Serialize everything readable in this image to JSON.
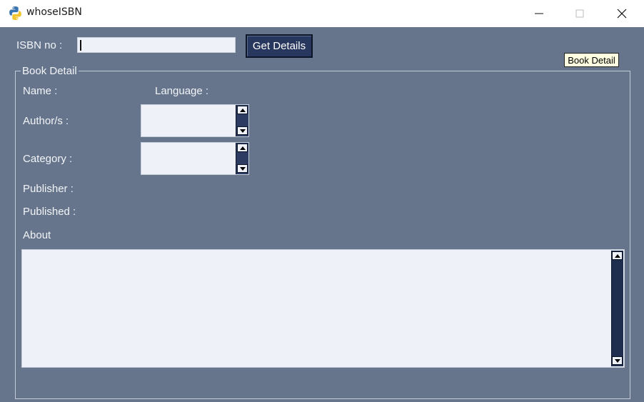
{
  "window": {
    "title": "whoseISBN",
    "icon": "python-icon",
    "controls": [
      "minimize-icon",
      "maximize-icon",
      "close-icon"
    ]
  },
  "isbn": {
    "label": "ISBN no :",
    "value": ""
  },
  "get_details_button": "Get Details",
  "tooltip": "Book Detail",
  "book_detail": {
    "legend": "Book Detail",
    "name_label": "Name :",
    "language_label": "Language :",
    "authors_label": "Author/s :",
    "category_label": "Category :",
    "publisher_label": "Publisher :",
    "published_label": "Published :",
    "about_label": "About"
  },
  "colors": {
    "background": "#66758c",
    "button": "#27375d",
    "field": "#eef1f7",
    "tooltip": "#ffffe1"
  }
}
